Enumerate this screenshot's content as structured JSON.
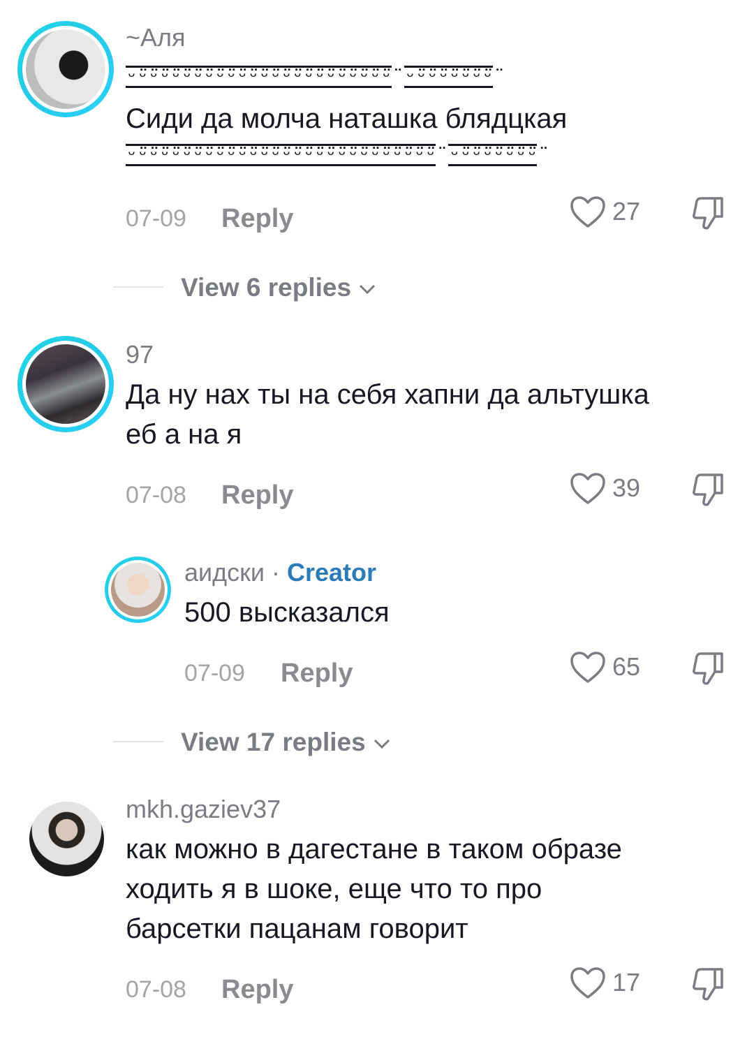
{
  "comments": [
    {
      "username": "~Аля",
      "deco1a": "ᵕ̈ᵕ̈ᵕ̈ᵕ̈ᵕ̈ᵕ̈ᵕ̈ᵕ̈ᵕ̈ᵕ̈ᵕ̈ᵕ̈ᵕ̈ᵕ̈ᵕ̈ᵕ̈ᵕ̈ᵕ̈ᵕ̈ᵕ̈ᵕ̈ᵕ̈ᵕ̈ᵕ̈",
      "deco1b": "ᵕ̈ᵕ̈ᵕ̈ᵕ̈ᵕ̈ᵕ̈ᵕ̈ᵕ̈",
      "text": "Сиди да молча наташка блядцкая",
      "deco2a": "ᵕ̈ᵕ̈ᵕ̈ᵕ̈ᵕ̈ᵕ̈ᵕ̈ᵕ̈ᵕ̈ᵕ̈ᵕ̈ᵕ̈ᵕ̈ᵕ̈ᵕ̈ᵕ̈ᵕ̈ᵕ̈ᵕ̈ᵕ̈ᵕ̈ᵕ̈ᵕ̈ᵕ̈ᵕ̈ᵕ̈ᵕ̈ᵕ̈",
      "deco2b": "ᵕ̈ᵕ̈ᵕ̈ᵕ̈ᵕ̈ᵕ̈ᵕ̈ᵕ̈",
      "date": "07-09",
      "reply": "Reply",
      "likes": "27",
      "view_replies": "View 6 replies"
    },
    {
      "username": "97",
      "text_line1": "Да ну нах ты на себя хапни да альтушка",
      "text_line2": "еб а на я",
      "date": "07-08",
      "reply": "Reply",
      "likes": "39"
    },
    {
      "username": "аидски",
      "separator": " · ",
      "badge": "Creator",
      "text": "500 высказался",
      "date": "07-09",
      "reply": "Reply",
      "likes": "65",
      "view_replies": "View 17 replies"
    },
    {
      "username": "mkh.gaziev37",
      "text_line1": "как можно в дагестане в таком образе",
      "text_line2": "ходить я в шоке, еще что то про",
      "text_line3": "барсетки пацанам говорит",
      "date": "07-08",
      "reply": "Reply",
      "likes": "17"
    }
  ],
  "colors": {
    "ring": "#26c9e8",
    "creator": "#2b7bb9",
    "muted": "#7a7c84"
  },
  "icons": [
    "heart-icon",
    "dislike-icon",
    "chevron-down-icon"
  ]
}
